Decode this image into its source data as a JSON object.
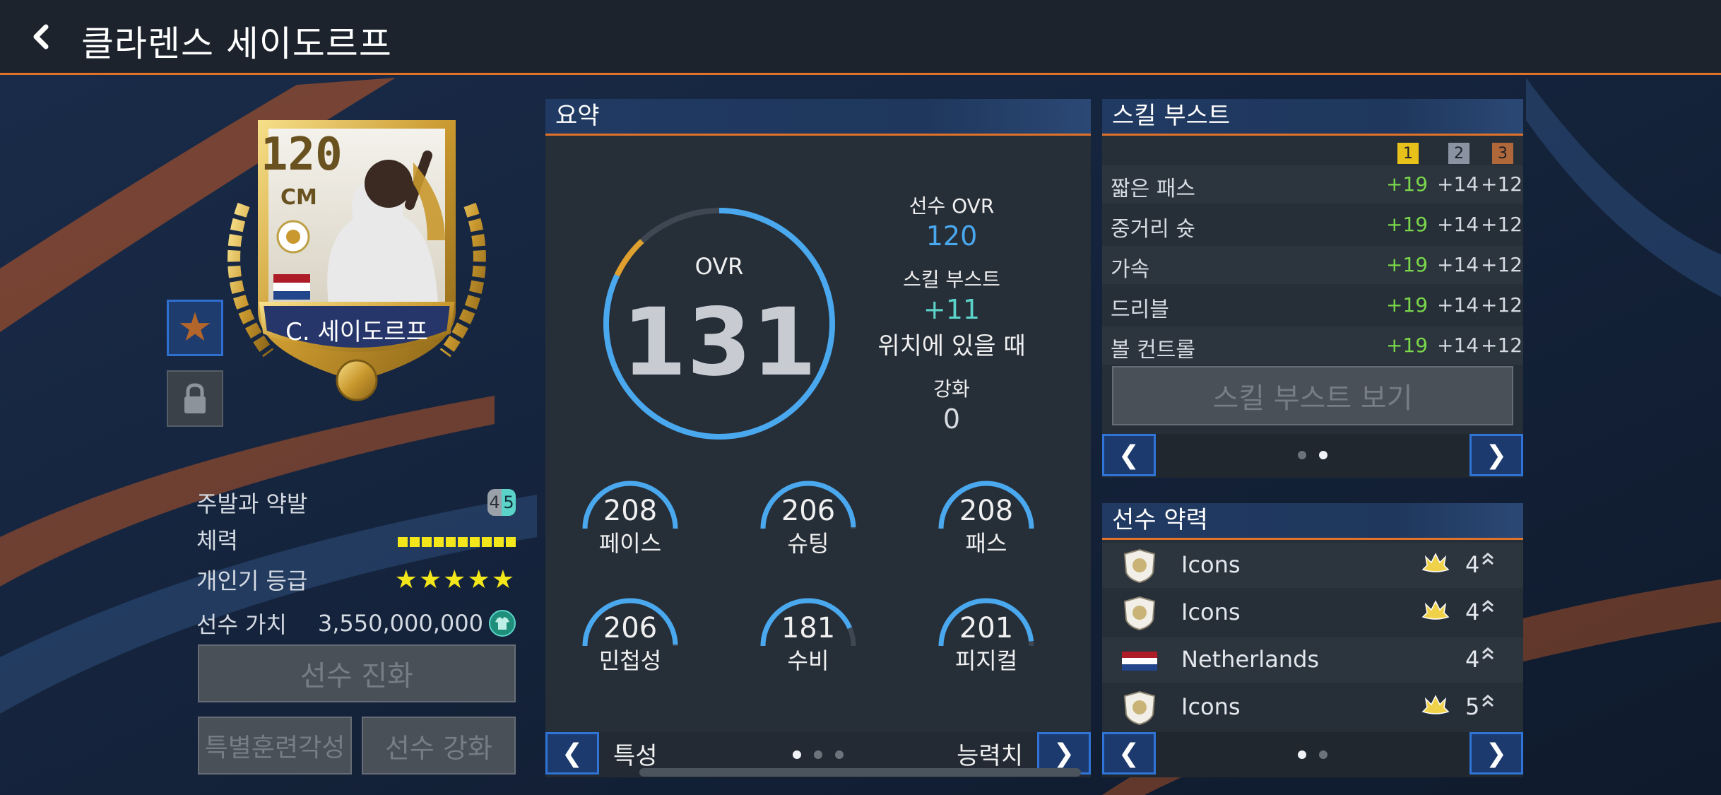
{
  "header": {
    "title": "클라렌스 세이도르프"
  },
  "card": {
    "ovr": "120",
    "position": "CM",
    "name": "C. 세이도르프"
  },
  "info": {
    "foot_label": "주발과 약발",
    "foot_left": "4",
    "foot_right": "5",
    "stamina_label": "체력",
    "stamina_segments": 10,
    "popularity_label": "개인기 등급",
    "popularity_stars": "★★★★★",
    "value_label": "선수 가치",
    "value": "3,550,000,000"
  },
  "buttons": {
    "evolve": "선수 진화",
    "special_training": "특별훈련각성",
    "enhance": "선수 강화"
  },
  "summary": {
    "title": "요약",
    "ovr_label": "OVR",
    "ovr_value": "131",
    "ovr_fraction": 0.88,
    "player_ovr_label": "선수 OVR",
    "player_ovr_value": "120",
    "skill_boost_label": "스킬 부스트",
    "skill_boost_value": "+11",
    "position_note": "위치에 있을 때",
    "enhance_label": "강화",
    "enhance_value": "0",
    "stats": [
      {
        "label": "페이스",
        "value": "208"
      },
      {
        "label": "슈팅",
        "value": "206"
      },
      {
        "label": "패스",
        "value": "208"
      },
      {
        "label": "민첩성",
        "value": "206"
      },
      {
        "label": "수비",
        "value": "181"
      },
      {
        "label": "피지컬",
        "value": "201"
      }
    ],
    "nav_left_label": "특성",
    "nav_right_label": "능력치",
    "prev_icon": "❮",
    "next_icon": "❯"
  },
  "skill_boost": {
    "title": "스킬 부스트",
    "col_headers": [
      "1",
      "2",
      "3"
    ],
    "col_colors": [
      "#e8c21a",
      "#8a93a1",
      "#b0683a"
    ],
    "rows": [
      {
        "name": "짧은 패스",
        "v1": "+19",
        "v2": "+14",
        "v3": "+12"
      },
      {
        "name": "중거리 슛",
        "v1": "+19",
        "v2": "+14",
        "v3": "+12"
      },
      {
        "name": "가속",
        "v1": "+19",
        "v2": "+14",
        "v3": "+12"
      },
      {
        "name": "드리블",
        "v1": "+19",
        "v2": "+14",
        "v3": "+12"
      },
      {
        "name": "볼 컨트롤",
        "v1": "+19",
        "v2": "+14",
        "v3": "+12"
      }
    ],
    "view_button": "스킬 부스트 보기",
    "prev_icon": "❮",
    "next_icon": "❯"
  },
  "traits": {
    "title": "선수 약력",
    "rows": [
      {
        "name": "Icons",
        "level": "4"
      },
      {
        "name": "Icons",
        "level": "4"
      },
      {
        "name": "Netherlands",
        "level": "4"
      },
      {
        "name": "Icons",
        "level": "5"
      }
    ],
    "prev_icon": "❮",
    "next_icon": "❯"
  },
  "colors": {
    "accent_orange": "#e0722a",
    "ring_blue": "#4aa8ee",
    "boost_green": "#7ad84a",
    "teal_value": "#5bd3c8",
    "blue_value": "#4aa8ee"
  }
}
